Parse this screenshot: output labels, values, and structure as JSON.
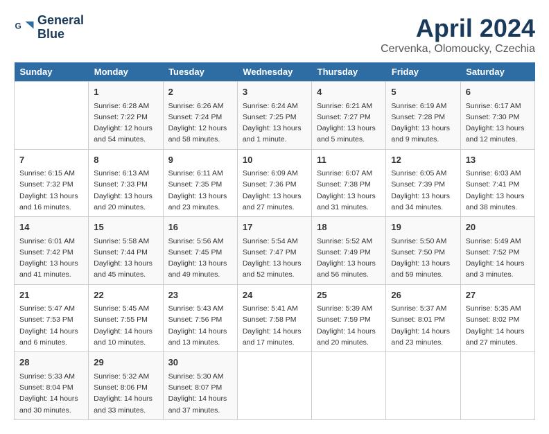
{
  "header": {
    "logo_line1": "General",
    "logo_line2": "Blue",
    "month_year": "April 2024",
    "location": "Cervenka, Olomoucky, Czechia"
  },
  "weekdays": [
    "Sunday",
    "Monday",
    "Tuesday",
    "Wednesday",
    "Thursday",
    "Friday",
    "Saturday"
  ],
  "weeks": [
    [
      {
        "day": "",
        "info": ""
      },
      {
        "day": "1",
        "info": "Sunrise: 6:28 AM\nSunset: 7:22 PM\nDaylight: 12 hours\nand 54 minutes."
      },
      {
        "day": "2",
        "info": "Sunrise: 6:26 AM\nSunset: 7:24 PM\nDaylight: 12 hours\nand 58 minutes."
      },
      {
        "day": "3",
        "info": "Sunrise: 6:24 AM\nSunset: 7:25 PM\nDaylight: 13 hours\nand 1 minute."
      },
      {
        "day": "4",
        "info": "Sunrise: 6:21 AM\nSunset: 7:27 PM\nDaylight: 13 hours\nand 5 minutes."
      },
      {
        "day": "5",
        "info": "Sunrise: 6:19 AM\nSunset: 7:28 PM\nDaylight: 13 hours\nand 9 minutes."
      },
      {
        "day": "6",
        "info": "Sunrise: 6:17 AM\nSunset: 7:30 PM\nDaylight: 13 hours\nand 12 minutes."
      }
    ],
    [
      {
        "day": "7",
        "info": "Sunrise: 6:15 AM\nSunset: 7:32 PM\nDaylight: 13 hours\nand 16 minutes."
      },
      {
        "day": "8",
        "info": "Sunrise: 6:13 AM\nSunset: 7:33 PM\nDaylight: 13 hours\nand 20 minutes."
      },
      {
        "day": "9",
        "info": "Sunrise: 6:11 AM\nSunset: 7:35 PM\nDaylight: 13 hours\nand 23 minutes."
      },
      {
        "day": "10",
        "info": "Sunrise: 6:09 AM\nSunset: 7:36 PM\nDaylight: 13 hours\nand 27 minutes."
      },
      {
        "day": "11",
        "info": "Sunrise: 6:07 AM\nSunset: 7:38 PM\nDaylight: 13 hours\nand 31 minutes."
      },
      {
        "day": "12",
        "info": "Sunrise: 6:05 AM\nSunset: 7:39 PM\nDaylight: 13 hours\nand 34 minutes."
      },
      {
        "day": "13",
        "info": "Sunrise: 6:03 AM\nSunset: 7:41 PM\nDaylight: 13 hours\nand 38 minutes."
      }
    ],
    [
      {
        "day": "14",
        "info": "Sunrise: 6:01 AM\nSunset: 7:42 PM\nDaylight: 13 hours\nand 41 minutes."
      },
      {
        "day": "15",
        "info": "Sunrise: 5:58 AM\nSunset: 7:44 PM\nDaylight: 13 hours\nand 45 minutes."
      },
      {
        "day": "16",
        "info": "Sunrise: 5:56 AM\nSunset: 7:45 PM\nDaylight: 13 hours\nand 49 minutes."
      },
      {
        "day": "17",
        "info": "Sunrise: 5:54 AM\nSunset: 7:47 PM\nDaylight: 13 hours\nand 52 minutes."
      },
      {
        "day": "18",
        "info": "Sunrise: 5:52 AM\nSunset: 7:49 PM\nDaylight: 13 hours\nand 56 minutes."
      },
      {
        "day": "19",
        "info": "Sunrise: 5:50 AM\nSunset: 7:50 PM\nDaylight: 13 hours\nand 59 minutes."
      },
      {
        "day": "20",
        "info": "Sunrise: 5:49 AM\nSunset: 7:52 PM\nDaylight: 14 hours\nand 3 minutes."
      }
    ],
    [
      {
        "day": "21",
        "info": "Sunrise: 5:47 AM\nSunset: 7:53 PM\nDaylight: 14 hours\nand 6 minutes."
      },
      {
        "day": "22",
        "info": "Sunrise: 5:45 AM\nSunset: 7:55 PM\nDaylight: 14 hours\nand 10 minutes."
      },
      {
        "day": "23",
        "info": "Sunrise: 5:43 AM\nSunset: 7:56 PM\nDaylight: 14 hours\nand 13 minutes."
      },
      {
        "day": "24",
        "info": "Sunrise: 5:41 AM\nSunset: 7:58 PM\nDaylight: 14 hours\nand 17 minutes."
      },
      {
        "day": "25",
        "info": "Sunrise: 5:39 AM\nSunset: 7:59 PM\nDaylight: 14 hours\nand 20 minutes."
      },
      {
        "day": "26",
        "info": "Sunrise: 5:37 AM\nSunset: 8:01 PM\nDaylight: 14 hours\nand 23 minutes."
      },
      {
        "day": "27",
        "info": "Sunrise: 5:35 AM\nSunset: 8:02 PM\nDaylight: 14 hours\nand 27 minutes."
      }
    ],
    [
      {
        "day": "28",
        "info": "Sunrise: 5:33 AM\nSunset: 8:04 PM\nDaylight: 14 hours\nand 30 minutes."
      },
      {
        "day": "29",
        "info": "Sunrise: 5:32 AM\nSunset: 8:06 PM\nDaylight: 14 hours\nand 33 minutes."
      },
      {
        "day": "30",
        "info": "Sunrise: 5:30 AM\nSunset: 8:07 PM\nDaylight: 14 hours\nand 37 minutes."
      },
      {
        "day": "",
        "info": ""
      },
      {
        "day": "",
        "info": ""
      },
      {
        "day": "",
        "info": ""
      },
      {
        "day": "",
        "info": ""
      }
    ]
  ]
}
